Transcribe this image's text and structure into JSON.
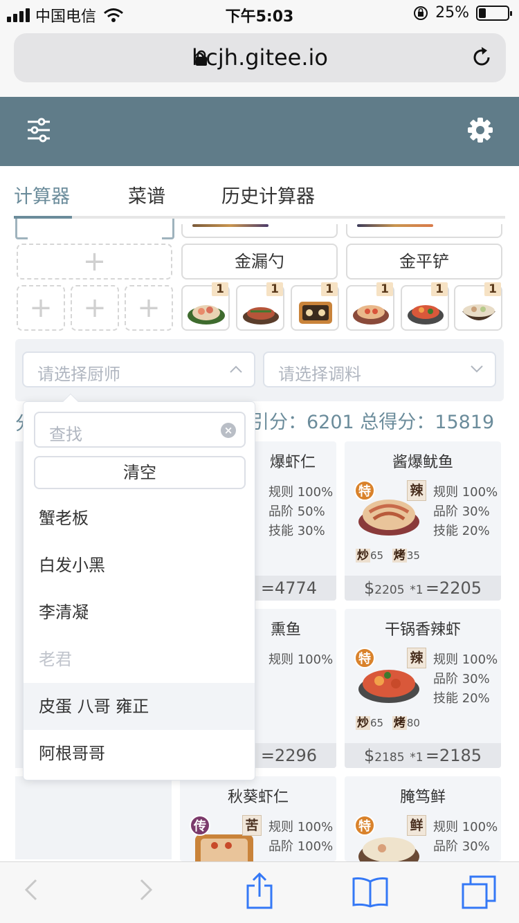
{
  "status_bar": {
    "carrier": "中国电信",
    "time": "下午5:03",
    "battery": "25%",
    "battery_level": 0.25
  },
  "browser": {
    "url": "bcjh.gitee.io"
  },
  "tabs": [
    {
      "label": "计算器",
      "active": true
    },
    {
      "label": "菜谱"
    },
    {
      "label": "历史计算器"
    }
  ],
  "utensils": {
    "left": "金漏勺",
    "right": "金平铲"
  },
  "materials": [
    {
      "count": "1"
    },
    {
      "count": "1"
    },
    {
      "count": "1"
    },
    {
      "count": "1"
    },
    {
      "count": "1"
    },
    {
      "count": "1"
    }
  ],
  "selects": {
    "chef_placeholder": "请选择厨师",
    "seasoning_placeholder": "请选择调料"
  },
  "score": {
    "left_fragment": "分",
    "text": "引分：6201  总得分：15819"
  },
  "dropdown": {
    "search_placeholder": "查找",
    "clear_label": "清空",
    "options": [
      {
        "label": "蟹老板"
      },
      {
        "label": "白发小黑"
      },
      {
        "label": "李清凝"
      },
      {
        "label": "老君",
        "disabled": true
      },
      {
        "label": "皮蛋 八哥 雍正",
        "hovered": true
      },
      {
        "label": "阿根哥哥"
      }
    ]
  },
  "recipes": [
    {
      "title": "爆虾仁",
      "rules": [
        "规则 100%",
        "品阶 50%",
        "技能 30%"
      ],
      "total": "=4774"
    },
    {
      "title": "酱爆鱿鱼",
      "spec": "特",
      "tag": "辣",
      "rules": [
        "规则 100%",
        "品阶 30%",
        "技能 20%"
      ],
      "skills": [
        [
          "炒",
          "65"
        ],
        [
          "烤",
          "35"
        ]
      ],
      "price": "2205",
      "mult": "*1",
      "total": "=2205"
    },
    {
      "title": "熏鱼",
      "rules": [
        "规则 100%"
      ],
      "total": "=2296"
    },
    {
      "title": "干锅香辣虾",
      "spec": "特",
      "tag": "辣",
      "rules": [
        "规则 100%",
        "品阶 30%",
        "技能 20%"
      ],
      "skills": [
        [
          "炒",
          "65"
        ],
        [
          "烤",
          "80"
        ]
      ],
      "price": "2185",
      "mult": "*1",
      "total": "=2185"
    },
    {
      "title": "秋葵虾仁",
      "spec": "传",
      "tag": "苦",
      "rules": [
        "规则 100%",
        "品阶 100%"
      ]
    },
    {
      "title": "腌笃鲜",
      "spec": "特",
      "tag": "鲜",
      "rules": [
        "规则 100%",
        "品阶 30%"
      ]
    }
  ],
  "colors": {
    "header": "#607c89",
    "accent": "#6b8c9b"
  }
}
